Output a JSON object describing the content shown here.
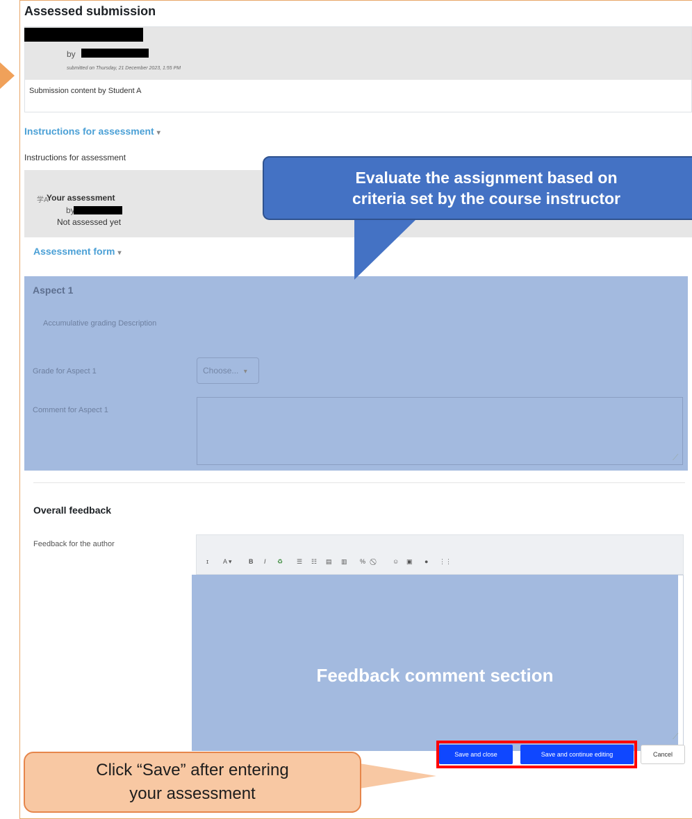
{
  "page": {
    "title": "Assessed submission"
  },
  "submission": {
    "by_label": "by",
    "submitted_on": "submitted on Thursday, 21 December 2023, 1:55 PM",
    "content": "Submission content by Student A"
  },
  "instructions": {
    "heading": "Instructions for assessment",
    "text": "Instructions for assessment"
  },
  "your_assessment": {
    "icon_text": "学A",
    "title": "Your assessment",
    "by_label": "by",
    "status": "Not assessed yet"
  },
  "assessment_form": {
    "heading": "Assessment form",
    "aspect_title": "Aspect 1",
    "aspect_description": "Accumulative grading Description",
    "grade_label": "Grade for Aspect 1",
    "grade_select_value": "Choose...",
    "comment_label": "Comment for Aspect 1"
  },
  "overall_feedback": {
    "heading": "Overall feedback",
    "feedback_label": "Feedback for the author",
    "area_label": "Feedback comment section"
  },
  "toolbar": {
    "buttons": [
      "ɪ",
      "A ▾",
      "B",
      "I",
      "♻",
      "☰",
      "☷",
      "▤",
      "▥",
      "%",
      "⃠",
      "☺",
      "▣",
      "●",
      "⋮⋮"
    ]
  },
  "buttons": {
    "save_close": "Save and close",
    "save_continue": "Save and continue editing",
    "cancel": "Cancel"
  },
  "callouts": {
    "blue_text": "Evaluate the assignment based on\ncriteria set by the course instructor",
    "orange_line1": "Click “Save” after entering",
    "orange_line2": "your assessment"
  },
  "colors": {
    "link": "#4ba0d6",
    "highlight": "#a3badf",
    "callout_blue": "#4472c4",
    "callout_orange": "#f8c8a3",
    "primary_button": "#0f47ff",
    "red_box": "#ff0000"
  }
}
